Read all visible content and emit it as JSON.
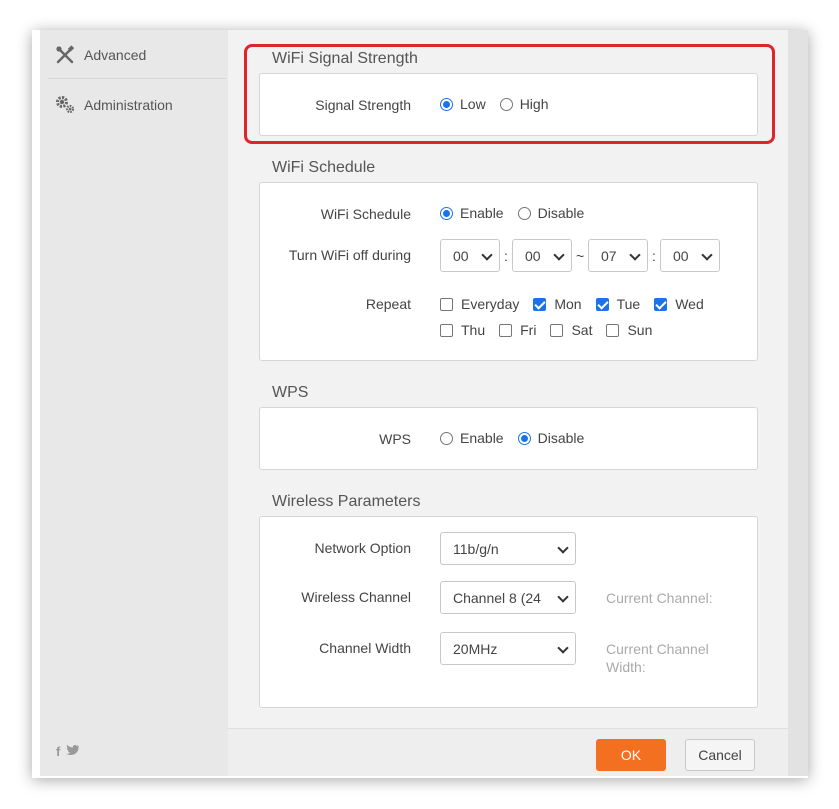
{
  "sidebar": {
    "items": [
      {
        "label": "Advanced",
        "icon": "tools-icon"
      },
      {
        "label": "Administration",
        "icon": "gears-icon"
      }
    ],
    "social": {
      "facebook": "f",
      "twitter": "t"
    }
  },
  "signal_section": {
    "title": "WiFi Signal Strength",
    "label": "Signal Strength",
    "options": [
      {
        "label": "Low",
        "selected": true
      },
      {
        "label": "High",
        "selected": false
      }
    ]
  },
  "schedule_section": {
    "title": "WiFi Schedule",
    "schedule_label": "WiFi Schedule",
    "schedule_options": [
      {
        "label": "Enable",
        "selected": true
      },
      {
        "label": "Disable",
        "selected": false
      }
    ],
    "off_label": "Turn WiFi off during",
    "start_hour": "00",
    "start_min": "00",
    "range_sep": "~",
    "time_sep": ":",
    "end_hour": "07",
    "end_min": "00",
    "repeat_label": "Repeat",
    "days": [
      {
        "label": "Everyday",
        "checked": false
      },
      {
        "label": "Mon",
        "checked": true
      },
      {
        "label": "Tue",
        "checked": true
      },
      {
        "label": "Wed",
        "checked": true
      },
      {
        "label": "Thu",
        "checked": false
      },
      {
        "label": "Fri",
        "checked": false
      },
      {
        "label": "Sat",
        "checked": false
      },
      {
        "label": "Sun",
        "checked": false
      }
    ]
  },
  "wps_section": {
    "title": "WPS",
    "label": "WPS",
    "options": [
      {
        "label": "Enable",
        "selected": false
      },
      {
        "label": "Disable",
        "selected": true
      }
    ]
  },
  "wireless_section": {
    "title": "Wireless Parameters",
    "network_label": "Network Option",
    "network_value": "11b/g/n",
    "channel_label": "Wireless Channel",
    "channel_value": "Channel 8 (24",
    "current_channel": "Current Channel:",
    "width_label": "Channel Width",
    "width_value": "20MHz",
    "current_width_line1": "Current Channel",
    "current_width_line2": "Width:"
  },
  "footer": {
    "ok_label": "OK",
    "cancel_label": "Cancel"
  },
  "colors": {
    "accent": "#1a73e8",
    "ok_button": "#f37021",
    "highlight": "#e0242b"
  }
}
